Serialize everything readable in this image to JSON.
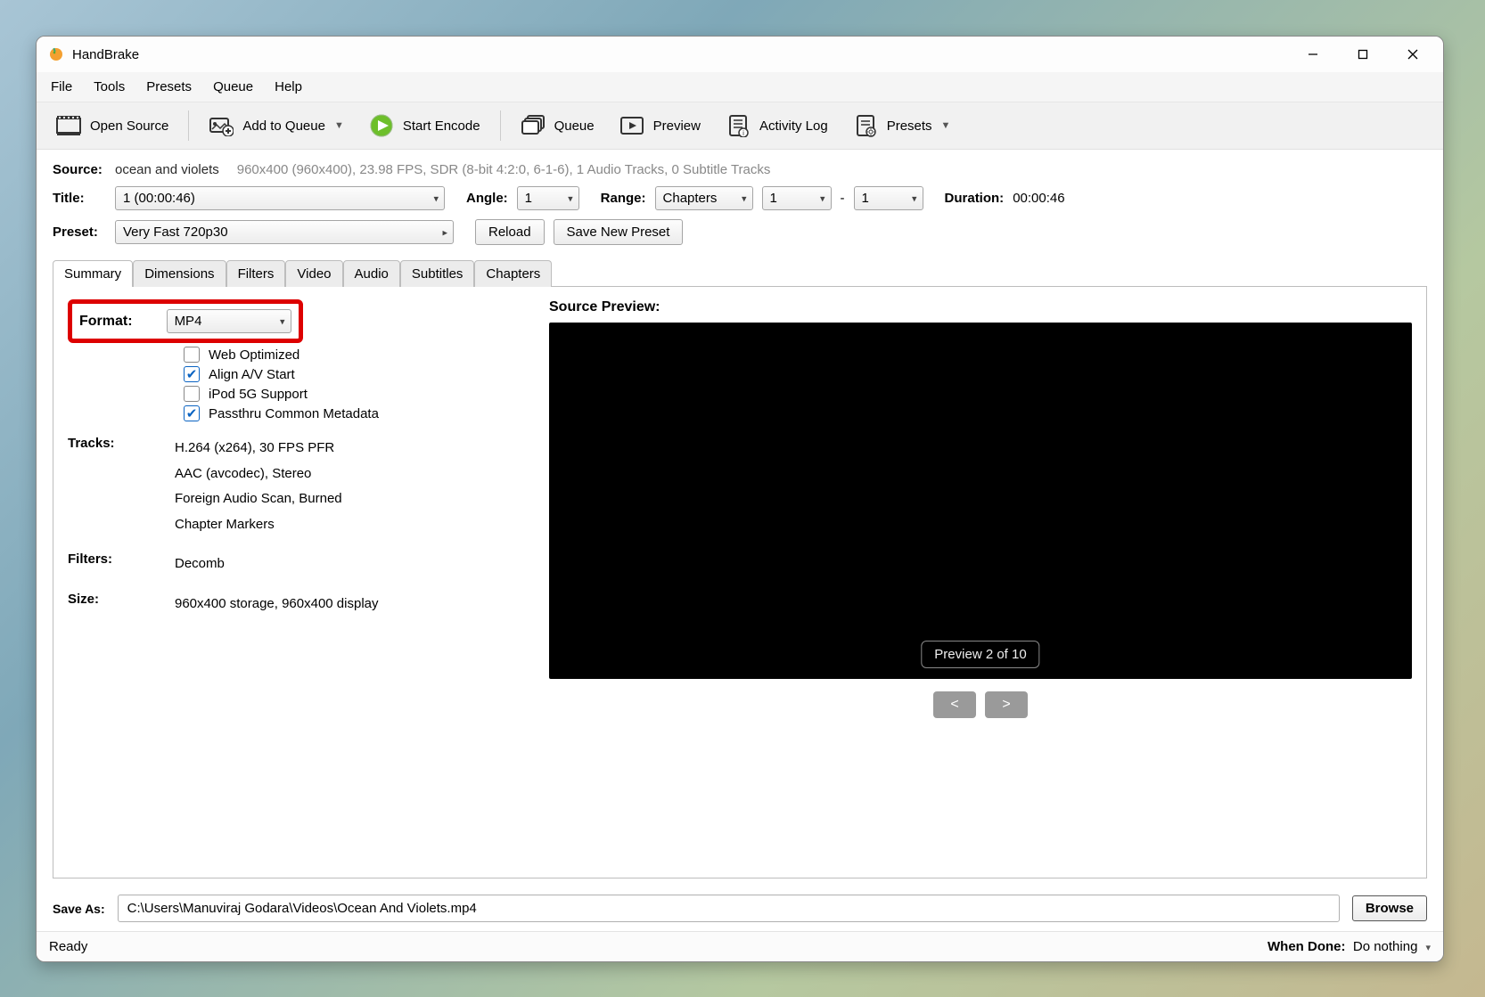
{
  "title": "HandBrake",
  "menus": [
    "File",
    "Tools",
    "Presets",
    "Queue",
    "Help"
  ],
  "toolbar": {
    "open": "Open Source",
    "add": "Add to Queue",
    "start": "Start Encode",
    "queue": "Queue",
    "preview": "Preview",
    "log": "Activity Log",
    "presets": "Presets"
  },
  "source": {
    "label": "Source:",
    "name": "ocean and violets",
    "meta": "960x400 (960x400), 23.98 FPS, SDR (8-bit 4:2:0, 6-1-6), 1 Audio Tracks, 0 Subtitle Tracks"
  },
  "title_row": {
    "label": "Title:",
    "value": "1  (00:00:46)",
    "angle_label": "Angle:",
    "angle": "1",
    "range_label": "Range:",
    "range_mode": "Chapters",
    "range_from": "1",
    "range_sep": "-",
    "range_to": "1",
    "duration_label": "Duration:",
    "duration": "00:00:46"
  },
  "preset_row": {
    "label": "Preset:",
    "value": "Very Fast 720p30",
    "reload": "Reload",
    "savenew": "Save New Preset"
  },
  "tabs": [
    "Summary",
    "Dimensions",
    "Filters",
    "Video",
    "Audio",
    "Subtitles",
    "Chapters"
  ],
  "summary": {
    "format_label": "Format:",
    "format": "MP4",
    "webopt": "Web Optimized",
    "align": "Align A/V Start",
    "ipod": "iPod 5G Support",
    "passthru": "Passthru Common Metadata",
    "tracks_label": "Tracks:",
    "tracks": [
      "H.264 (x264), 30 FPS PFR",
      "AAC (avcodec), Stereo",
      "Foreign Audio Scan, Burned",
      "Chapter Markers"
    ],
    "filters_label": "Filters:",
    "filters": "Decomb",
    "size_label": "Size:",
    "size": "960x400 storage, 960x400 display"
  },
  "preview": {
    "title": "Source Preview:",
    "badge": "Preview 2 of 10",
    "prev": "<",
    "next": ">"
  },
  "save": {
    "label": "Save As:",
    "path": "C:\\Users\\Manuviraj Godara\\Videos\\Ocean And Violets.mp4",
    "browse": "Browse"
  },
  "status": {
    "ready": "Ready",
    "when_done_label": "When Done:",
    "when_done": "Do nothing"
  }
}
